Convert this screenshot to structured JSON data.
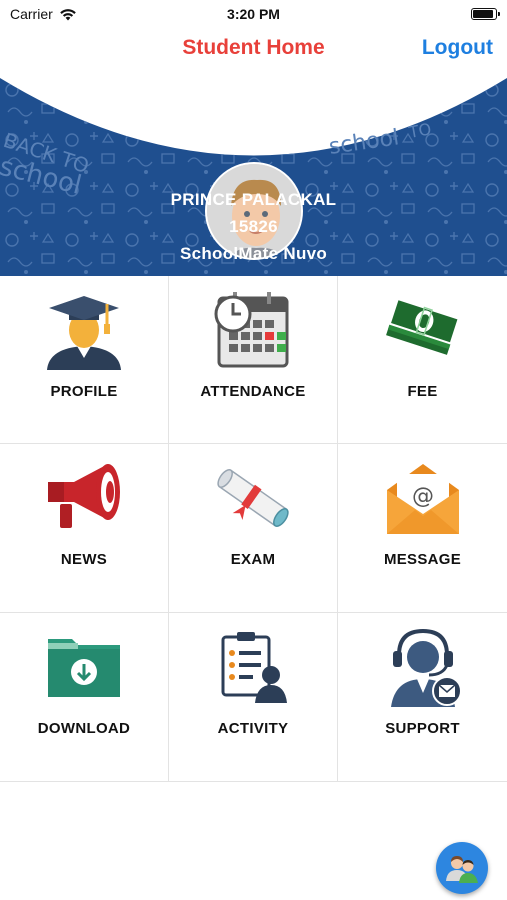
{
  "status_bar": {
    "carrier": "Carrier",
    "time": "3:20 PM",
    "battery_level": 0.95
  },
  "nav": {
    "title": "Student Home",
    "logout_label": "Logout",
    "title_color": "#e8403a",
    "action_color": "#1e7fe0"
  },
  "banner": {
    "background_color": "#1f4f8f",
    "student_name": "PRINCE PALACKAL",
    "student_id": "15826",
    "school_name": "SchoolMate Nuvo"
  },
  "menu": [
    {
      "label": "PROFILE",
      "icon": "graduate-icon"
    },
    {
      "label": "ATTENDANCE",
      "icon": "calendar-clock-icon"
    },
    {
      "label": "FEE",
      "icon": "money-icon"
    },
    {
      "label": "NEWS",
      "icon": "megaphone-icon"
    },
    {
      "label": "EXAM",
      "icon": "diploma-icon"
    },
    {
      "label": "MESSAGE",
      "icon": "envelope-icon"
    },
    {
      "label": "DOWNLOAD",
      "icon": "folder-download-icon"
    },
    {
      "label": "ACTIVITY",
      "icon": "clipboard-person-icon"
    },
    {
      "label": "SUPPORT",
      "icon": "support-agent-icon"
    }
  ],
  "fab": {
    "icon": "switch-user-icon"
  }
}
